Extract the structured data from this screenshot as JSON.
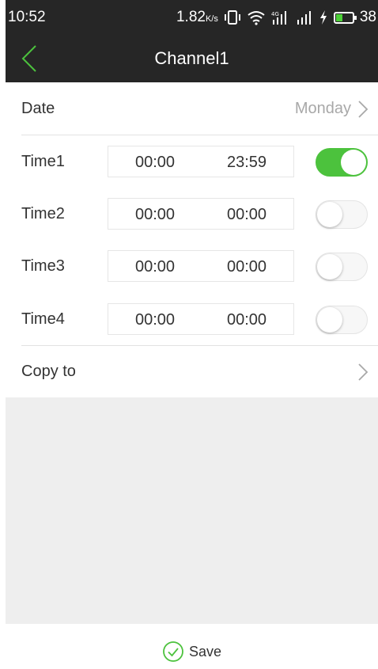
{
  "status_bar": {
    "time": "10:52",
    "net_speed": "1.82",
    "net_unit": "K/s",
    "battery_level": "38",
    "battery_fraction": 0.38
  },
  "nav": {
    "title": "Channel1",
    "back_icon": "chevron-left-icon"
  },
  "date_row": {
    "label": "Date",
    "value": "Monday"
  },
  "time_rows": [
    {
      "label": "Time1",
      "start": "00:00",
      "end": "23:59",
      "enabled": true
    },
    {
      "label": "Time2",
      "start": "00:00",
      "end": "00:00",
      "enabled": false
    },
    {
      "label": "Time3",
      "start": "00:00",
      "end": "00:00",
      "enabled": false
    },
    {
      "label": "Time4",
      "start": "00:00",
      "end": "00:00",
      "enabled": false
    }
  ],
  "copy_row": {
    "label": "Copy to"
  },
  "footer": {
    "save_label": "Save"
  },
  "colors": {
    "header_bg": "#262626",
    "accent_green": "#4cc23d",
    "panel_gray": "#eeeeee"
  }
}
